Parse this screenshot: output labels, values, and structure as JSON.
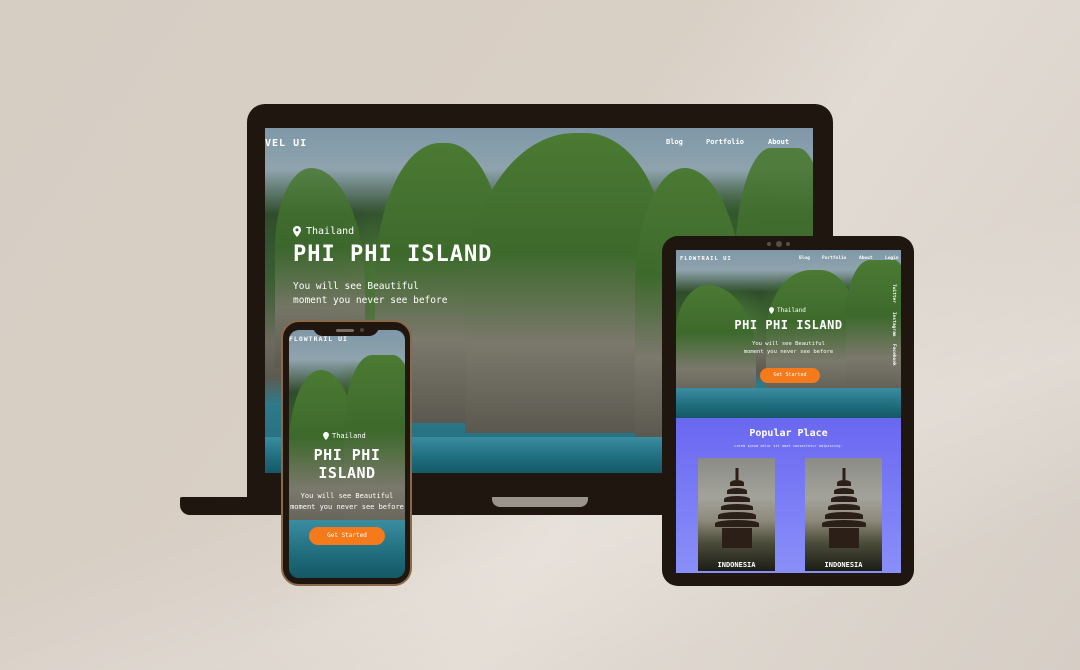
{
  "laptop": {
    "brand": "VEL UI",
    "nav": [
      "Blog",
      "Portfolio",
      "About"
    ],
    "location": "Thailand",
    "title": "PHI PHI ISLAND",
    "subtitle_line1": "You will see Beautiful",
    "subtitle_line2": "moment you never see before"
  },
  "tablet": {
    "brand": "FLOWTRAIL UI",
    "nav": [
      "Blog",
      "Portfolio",
      "About",
      "Login"
    ],
    "location": "Thailand",
    "title": "PHI PHI ISLAND",
    "subtitle_line1": "You will see Beautiful",
    "subtitle_line2": "moment you never see before",
    "cta": "Get Started",
    "social": [
      "Twitter",
      "Instagram",
      "Facebook"
    ],
    "section_title": "Popular Place",
    "section_subtitle": "Lorem ipsum dolor sit amet consectetur adipiscing.",
    "cards": [
      {
        "label": "INDONESIA"
      },
      {
        "label": "INDONESIA"
      }
    ]
  },
  "phone": {
    "brand": "FLOWTRAIL UI",
    "location": "Thailand",
    "title_line1": "PHI PHI",
    "title_line2": "ISLAND",
    "subtitle_line1": "You will see Beautiful",
    "subtitle_line2": "moment you never see before",
    "cta": "Get Started"
  },
  "colors": {
    "accent": "#f57a1c",
    "device_frame": "#1f160f",
    "section_bg": "#7b7cf5"
  }
}
